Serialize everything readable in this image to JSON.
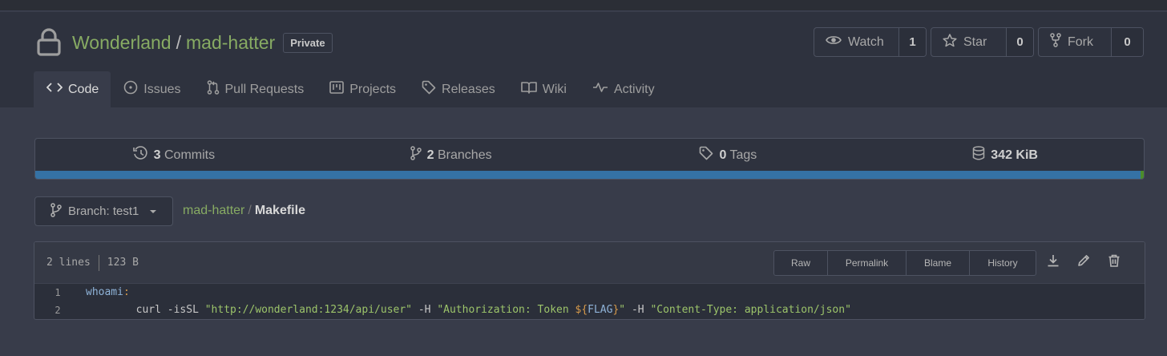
{
  "repo": {
    "owner": "Wonderland",
    "separator": "/",
    "name": "mad-hatter",
    "visibility": "Private"
  },
  "actions": {
    "watch": {
      "label": "Watch",
      "count": "1"
    },
    "star": {
      "label": "Star",
      "count": "0"
    },
    "fork": {
      "label": "Fork",
      "count": "0"
    }
  },
  "tabs": [
    {
      "label": "Code",
      "icon": "code-icon",
      "active": true
    },
    {
      "label": "Issues",
      "icon": "issue-icon"
    },
    {
      "label": "Pull Requests",
      "icon": "pull-request-icon"
    },
    {
      "label": "Projects",
      "icon": "project-icon"
    },
    {
      "label": "Releases",
      "icon": "tag-icon"
    },
    {
      "label": "Wiki",
      "icon": "book-icon"
    },
    {
      "label": "Activity",
      "icon": "pulse-icon"
    }
  ],
  "stats": {
    "commits": {
      "count": "3",
      "label": "Commits"
    },
    "branches": {
      "count": "2",
      "label": "Branches"
    },
    "tags": {
      "count": "0",
      "label": "Tags"
    },
    "size": {
      "value": "342 KiB"
    }
  },
  "colors": {
    "language_primary": "#3572a5",
    "language_secondary": "#4c8c2b",
    "repo_link": "#87ab63"
  },
  "branch": {
    "label": "Branch: test1"
  },
  "breadcrumb": {
    "repo": "mad-hatter",
    "separator": "/",
    "file": "Makefile"
  },
  "file": {
    "lines": "2 lines",
    "size": "123 B",
    "buttons": {
      "raw": "Raw",
      "permalink": "Permalink",
      "blame": "Blame",
      "history": "History"
    },
    "code": [
      {
        "number": "1",
        "target": "whoami",
        "colon": ":"
      },
      {
        "number": "2",
        "indent": "        ",
        "cmd": "curl -isSL ",
        "url": "\"http://wonderland:1234/api/user\"",
        "h1": " -H ",
        "auth_a": "\"Authorization: Token ",
        "var_open": "${",
        "var_name": "FLAG",
        "var_close": "}",
        "auth_b": "\"",
        "h2": " -H ",
        "ctype": "\"Content-Type: application/json\""
      }
    ]
  }
}
